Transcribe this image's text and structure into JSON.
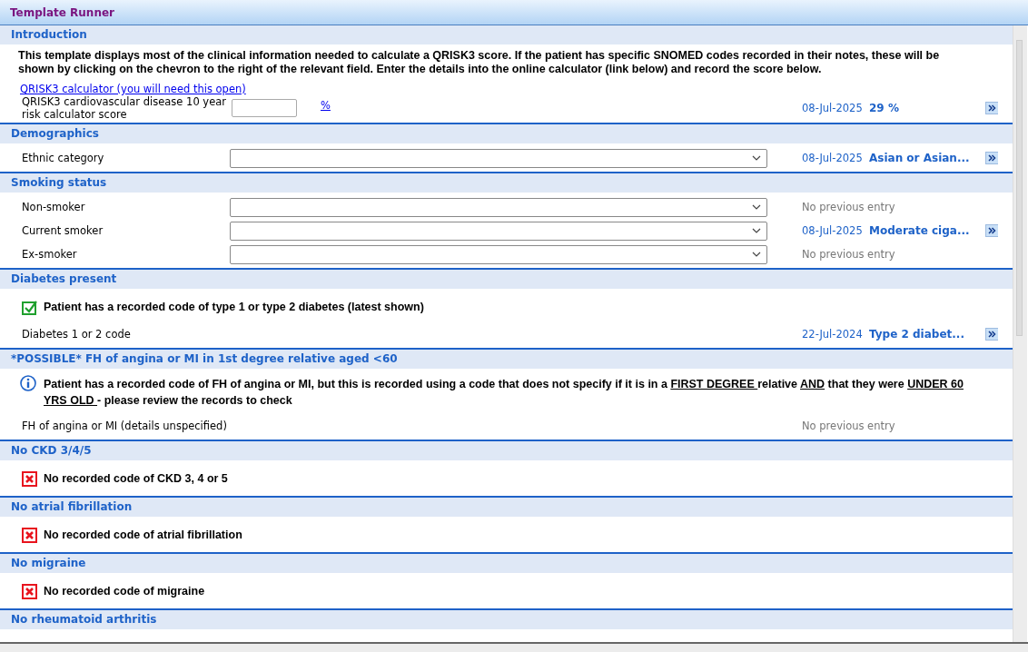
{
  "window": {
    "title": "Template Runner"
  },
  "sections": [
    {
      "title": "Introduction",
      "items": [
        {
          "kind": "paragraph",
          "text": "This template displays most of the clinical information needed to calculate a QRISK3 score. If the patient has specific SNOMED codes recorded in their notes, these will be shown by clicking on the chevron to the right of the relevant field. Enter the details into the online calculator (link below) and record the score below."
        },
        {
          "kind": "link",
          "text": "QRISK3 calculator (you will need this open)"
        },
        {
          "kind": "input",
          "label": "QRISK3 cardiovascular disease 10 year risk calculator score",
          "unit": "%",
          "date": "08-Jul-2025",
          "value": "29 %"
        }
      ]
    },
    {
      "title": "Demographics",
      "items": [
        {
          "kind": "dropdown",
          "label": "Ethnic category",
          "date": "08-Jul-2025",
          "value": "Asian or Asian..."
        }
      ]
    },
    {
      "title": "Smoking status",
      "items": [
        {
          "kind": "dropdown",
          "label": "Non-smoker",
          "note": "No previous entry"
        },
        {
          "kind": "dropdown",
          "label": "Current smoker",
          "date": "08-Jul-2025",
          "value": "Moderate ciga..."
        },
        {
          "kind": "dropdown",
          "label": "Ex-smoker",
          "note": "No previous entry"
        }
      ]
    },
    {
      "title": "Diabetes present",
      "items": [
        {
          "kind": "tick",
          "segments": [
            {
              "text": "Patient has a recorded code of type 1 or type 2 diabetes (latest shown)",
              "underline": false
            }
          ]
        },
        {
          "kind": "code",
          "label": "Diabetes 1 or 2 code",
          "date": "22-Jul-2024",
          "value": "Type 2 diabet..."
        }
      ]
    },
    {
      "title": "*POSSIBLE* FH of angina or MI in 1st degree relative aged <60",
      "items": [
        {
          "kind": "info",
          "segments": [
            {
              "text": "Patient has a recorded code of FH of angina or MI, but this is recorded using a code that does not specify if it is in a ",
              "underline": false
            },
            {
              "text": "FIRST DEGREE ",
              "underline": true
            },
            {
              "text": "relative ",
              "underline": false
            },
            {
              "text": "AND",
              "underline": true
            },
            {
              "text": " that they were ",
              "underline": false
            },
            {
              "text": "UNDER 60 YRS OLD ",
              "underline": true
            },
            {
              "text": "- please review the records to check",
              "underline": false
            }
          ]
        },
        {
          "kind": "code",
          "label": "FH of angina or MI (details unspecified)",
          "note": "No previous entry"
        }
      ]
    },
    {
      "title": "No CKD 3/4/5",
      "items": [
        {
          "kind": "cross",
          "segments": [
            {
              "text": "No recorded code of CKD 3, 4 or 5",
              "underline": false
            }
          ]
        }
      ]
    },
    {
      "title": "No atrial fibrillation",
      "items": [
        {
          "kind": "cross",
          "segments": [
            {
              "text": "No recorded code of atrial fibrillation",
              "underline": false
            }
          ]
        }
      ]
    },
    {
      "title": "No migraine",
      "items": [
        {
          "kind": "cross",
          "segments": [
            {
              "text": "No recorded code of migraine",
              "underline": false
            }
          ]
        }
      ]
    },
    {
      "title": "No rheumatoid arthritis"
    }
  ]
}
